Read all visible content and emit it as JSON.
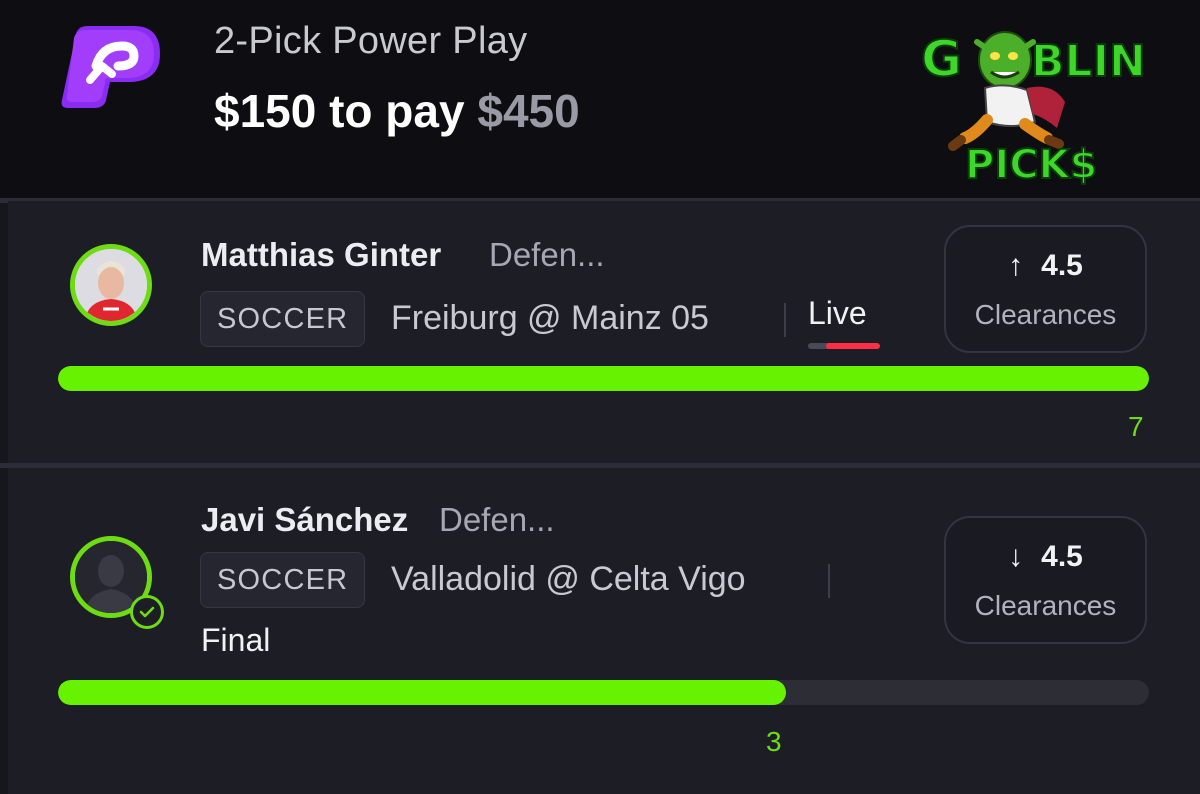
{
  "header": {
    "slip_type": "2-Pick Power Play",
    "stake": "$150 to pay",
    "payout": "$450",
    "app_logo_letter": "P",
    "brand_logo": {
      "word1": "GOBLIN",
      "word2": "PICK$"
    }
  },
  "picks": [
    {
      "player": "Matthias Ginter",
      "position": "Defen...",
      "sport": "SOCCER",
      "matchup": "Freiburg @ Mainz 05",
      "status": "Live",
      "live_progress": 0.75,
      "direction": "up",
      "direction_icon": "arrow-up-icon",
      "line": "4.5",
      "stat": "Clearances",
      "actual": "7",
      "progress": 1.0,
      "avatar_icon": "player-photo"
    },
    {
      "player": "Javi Sánchez",
      "position": "Defen...",
      "sport": "SOCCER",
      "matchup": "Valladolid @ Celta Vigo",
      "status": "Final",
      "direction": "down",
      "direction_icon": "arrow-down-icon",
      "line": "4.5",
      "stat": "Clearances",
      "actual": "3",
      "progress": 0.667,
      "avatar_icon": "player-silhouette",
      "check_icon": "checkmark-icon"
    }
  ],
  "colors": {
    "accent_green": "#66f200",
    "live_red": "#ff2d45",
    "app_purple": "#8b2cf5",
    "background": "#16161d"
  }
}
